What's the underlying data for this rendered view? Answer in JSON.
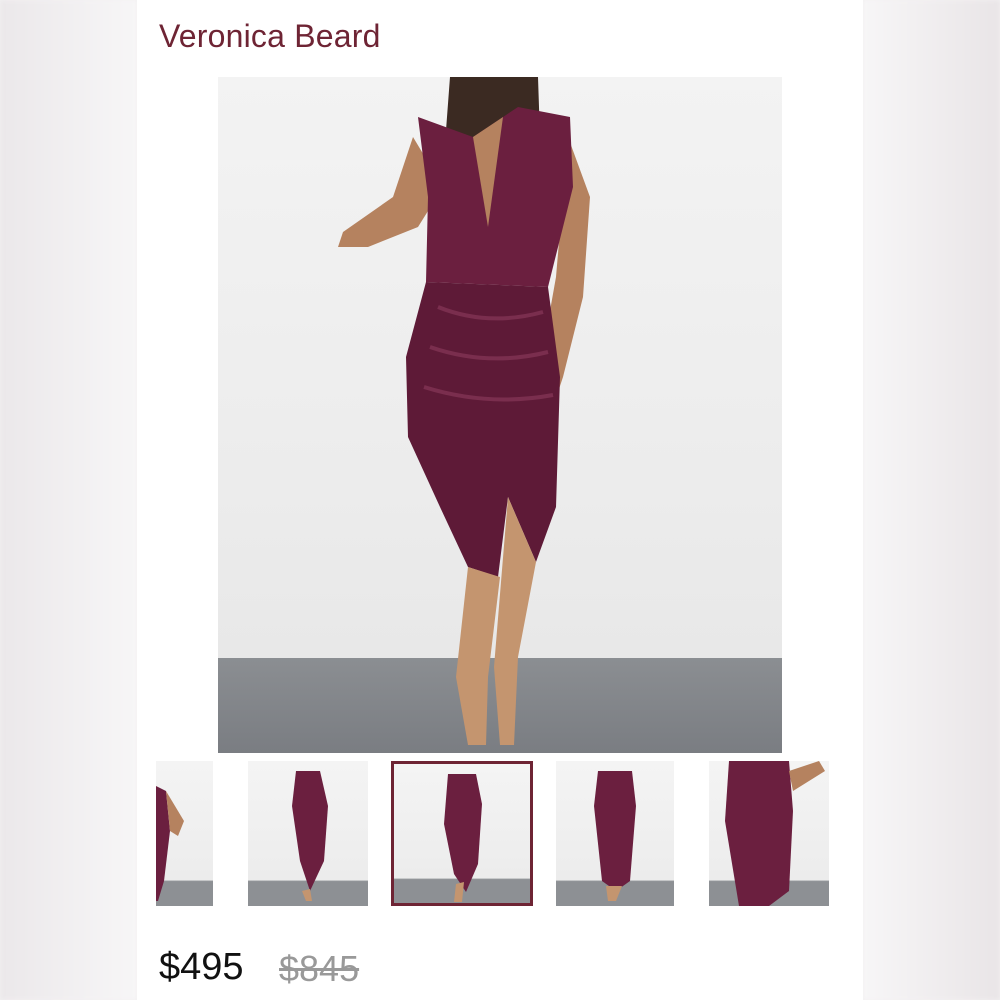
{
  "listing": {
    "brand": "Veronica Beard",
    "price": "$495",
    "original_price": "$845"
  },
  "gallery": {
    "main_image": "dress-photo",
    "thumbnails": [
      {
        "image": "dress-side-view"
      },
      {
        "image": "dress-front-full"
      },
      {
        "image": "dress-front-selected",
        "selected": true
      },
      {
        "image": "dress-back-view"
      },
      {
        "image": "dress-ruched-detail"
      }
    ]
  },
  "colors": {
    "accent": "#6e2434",
    "dress": "#6b1f3f"
  }
}
